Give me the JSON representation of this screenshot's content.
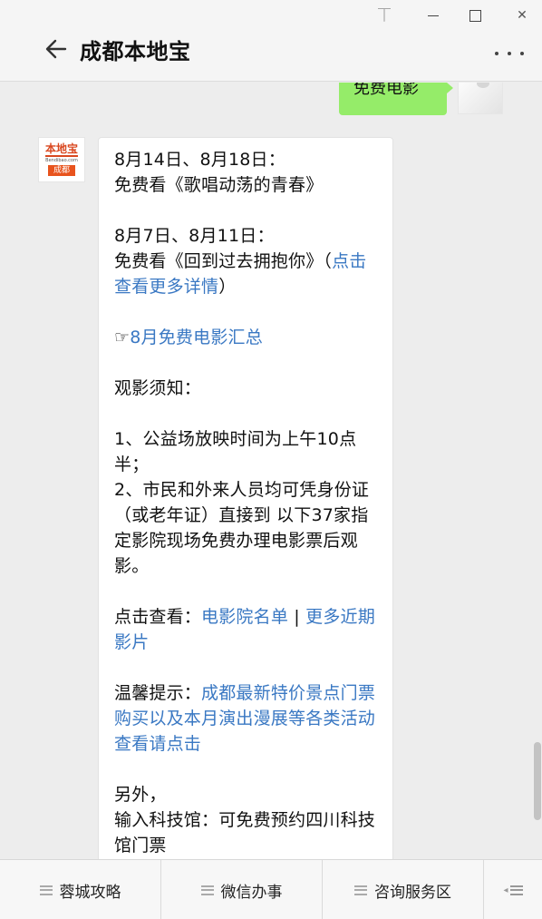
{
  "window": {
    "title": "成都本地宝",
    "pin_glyph": "⏉",
    "close_glyph": "✕"
  },
  "chat": {
    "sent_message": "免费电影",
    "bot_logo": {
      "name": "本地宝",
      "url": "Bendibao.com",
      "city": "成都"
    },
    "reply": {
      "l1": "8月14日、8月18日：",
      "l2": "免费看《歌唱动荡的青春》",
      "l3": "8月7日、8月11日：",
      "l4": "免费看《回到过去拥抱你》（",
      "l4_link": "点击查看更多详情",
      "l4_end": "）",
      "l5_icon": "☞",
      "l5_link": "8月免费电影汇总",
      "l6": "观影须知：",
      "l7": "1、公益场放映时间为上午10点半；",
      "l8": "2、市民和外来人员均可凭身份证（或老年证）直接到 以下37家指定影院现场免费办理电影票后观影。",
      "l9": "点击查看：",
      "l9_link1": "电影院名单",
      "l9_sep": " | ",
      "l9_link2": "更多近期影片",
      "l10": "温馨提示：",
      "l10_link": "成都最新特价景点门票购买以及本月演出漫展等各类活动查看请点击",
      "l11": "另外，",
      "l12": "输入科技馆：可免费预约四川科技馆门票"
    }
  },
  "menu": {
    "items": [
      "蓉城攻略",
      "微信办事",
      "咨询服务区"
    ]
  },
  "colors": {
    "sent_bubble": "#95ec69",
    "link": "#3a78c3",
    "brand": "#e8531d"
  }
}
